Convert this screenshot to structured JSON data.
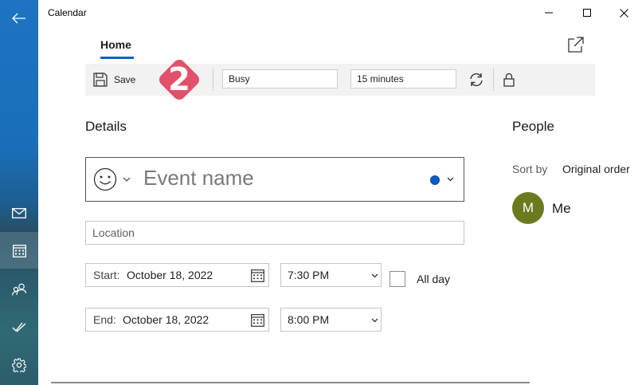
{
  "window": {
    "title": "Calendar"
  },
  "rail": {
    "items": [
      {
        "icon": "back-arrow-icon"
      },
      {
        "icon": "mail-icon"
      },
      {
        "icon": "calendar-icon",
        "active": true
      },
      {
        "icon": "people-icon"
      },
      {
        "icon": "todo-icon"
      },
      {
        "icon": "settings-gear-icon"
      }
    ]
  },
  "tabs": {
    "home_label": "Home"
  },
  "toolbar": {
    "save_label": "Save",
    "show_as_value": "Busy",
    "reminder_value": "15 minutes",
    "icons": [
      "save-icon",
      "repeat-icon",
      "lock-icon"
    ]
  },
  "step_badge": {
    "number": "2",
    "color": "#e2506a"
  },
  "details": {
    "heading": "Details",
    "event_name_placeholder": "Event name",
    "location_placeholder": "Location",
    "start_label": "Start:",
    "start_date": "October 18, 2022",
    "start_time": "7:30 PM",
    "end_label": "End:",
    "end_date": "October 18, 2022",
    "end_time": "8:00 PM",
    "all_day_label": "All day",
    "all_day_checked": false,
    "calendar_color": "#0b5cc4"
  },
  "people": {
    "heading": "People",
    "sort_label": "Sort by",
    "sort_value": "Original order",
    "attendees": [
      {
        "initial": "M",
        "name": "Me",
        "avatar_color": "#6b7a1f"
      }
    ]
  },
  "colors": {
    "accent": "#0a63c9",
    "toolbar_bg": "#f2f2f2"
  }
}
